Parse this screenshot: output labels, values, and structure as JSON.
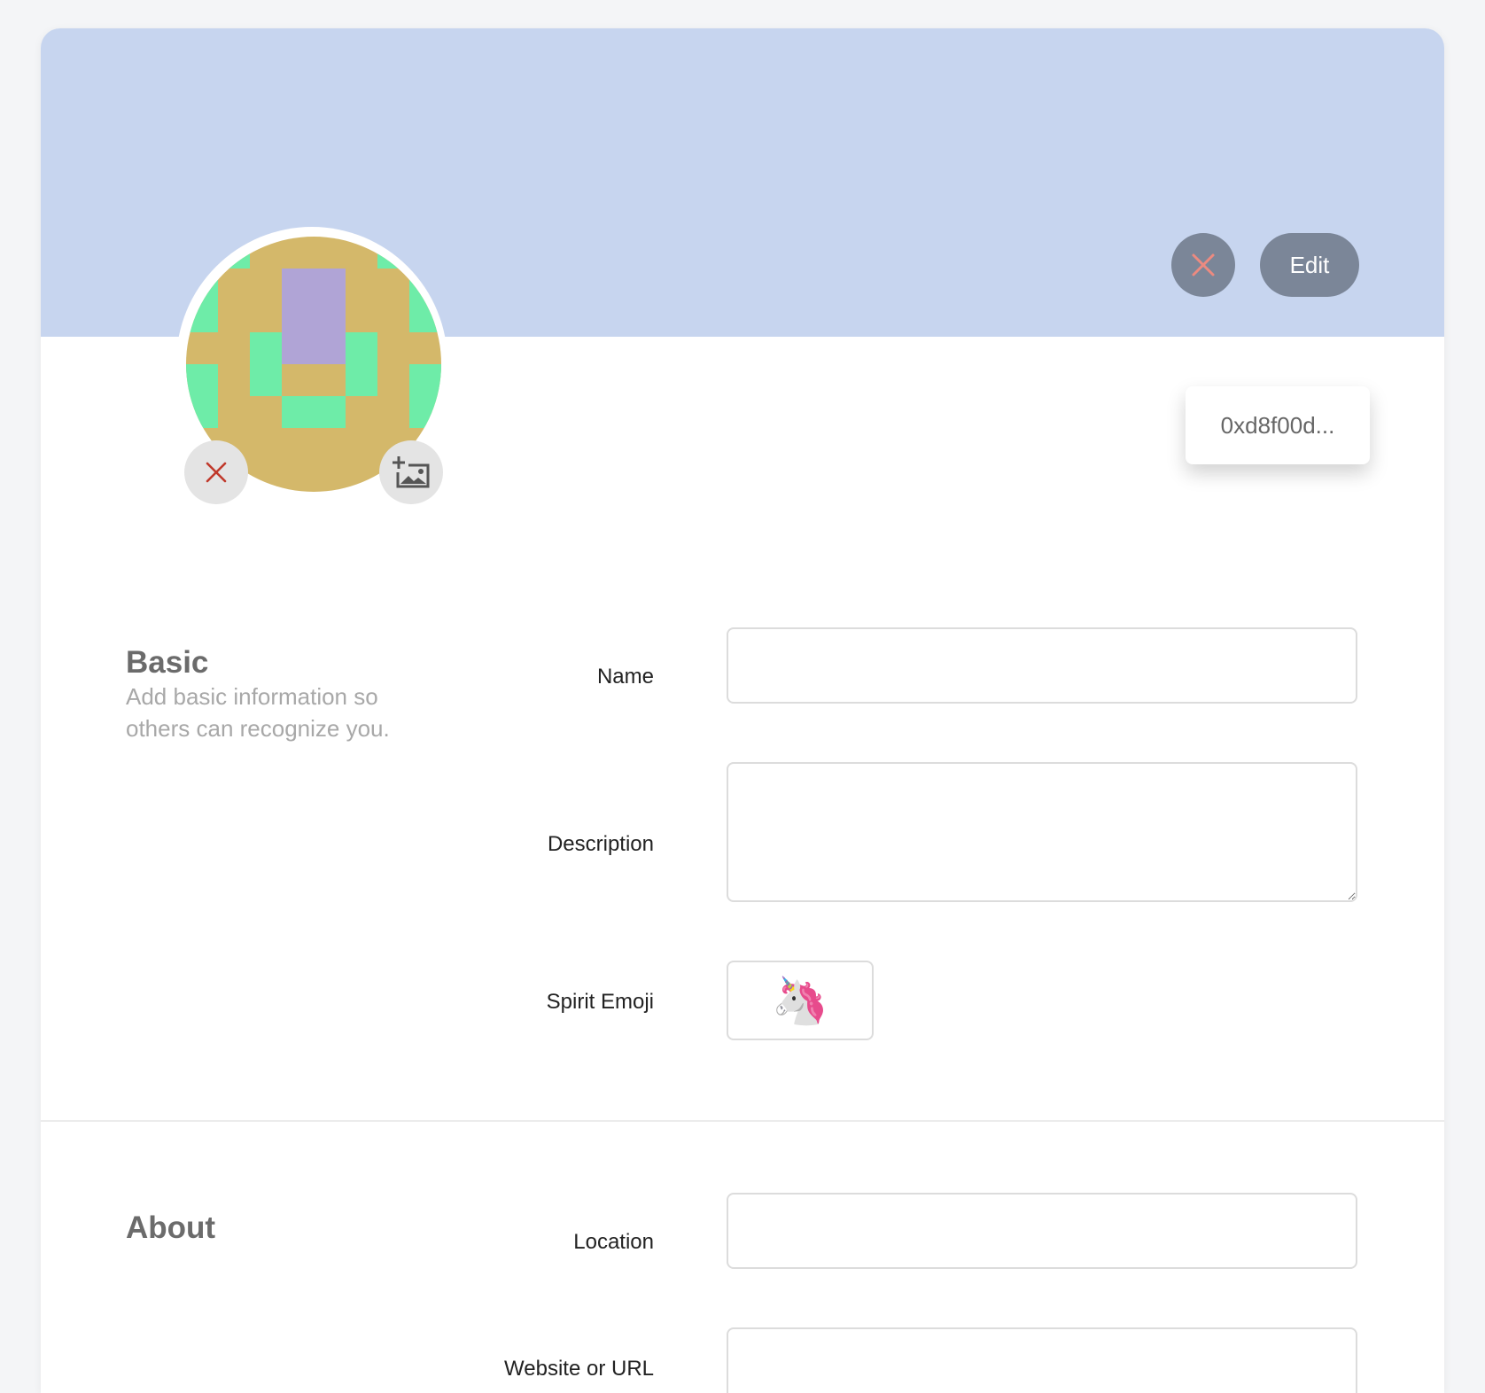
{
  "header": {
    "cancel_icon": "close-icon",
    "edit_label": "Edit",
    "accent_color": "#c7d5ef",
    "button_color": "#7b8698"
  },
  "avatar": {
    "remove_icon": "close-icon",
    "add_icon": "add-image-icon",
    "colors": {
      "base": "#d4b86a",
      "green": "#6eeca8",
      "purple": "#b0a4d6"
    }
  },
  "address": {
    "text": "0xd8f00d..."
  },
  "basic": {
    "title": "Basic",
    "description": "Add basic information so others can recognize you.",
    "name_label": "Name",
    "name_value": "",
    "description_label": "Description",
    "description_value": "",
    "emoji_label": "Spirit Emoji",
    "emoji_value": "🦄"
  },
  "about": {
    "title": "About",
    "location_label": "Location",
    "location_value": "",
    "website_label": "Website or URL",
    "website_value": ""
  }
}
